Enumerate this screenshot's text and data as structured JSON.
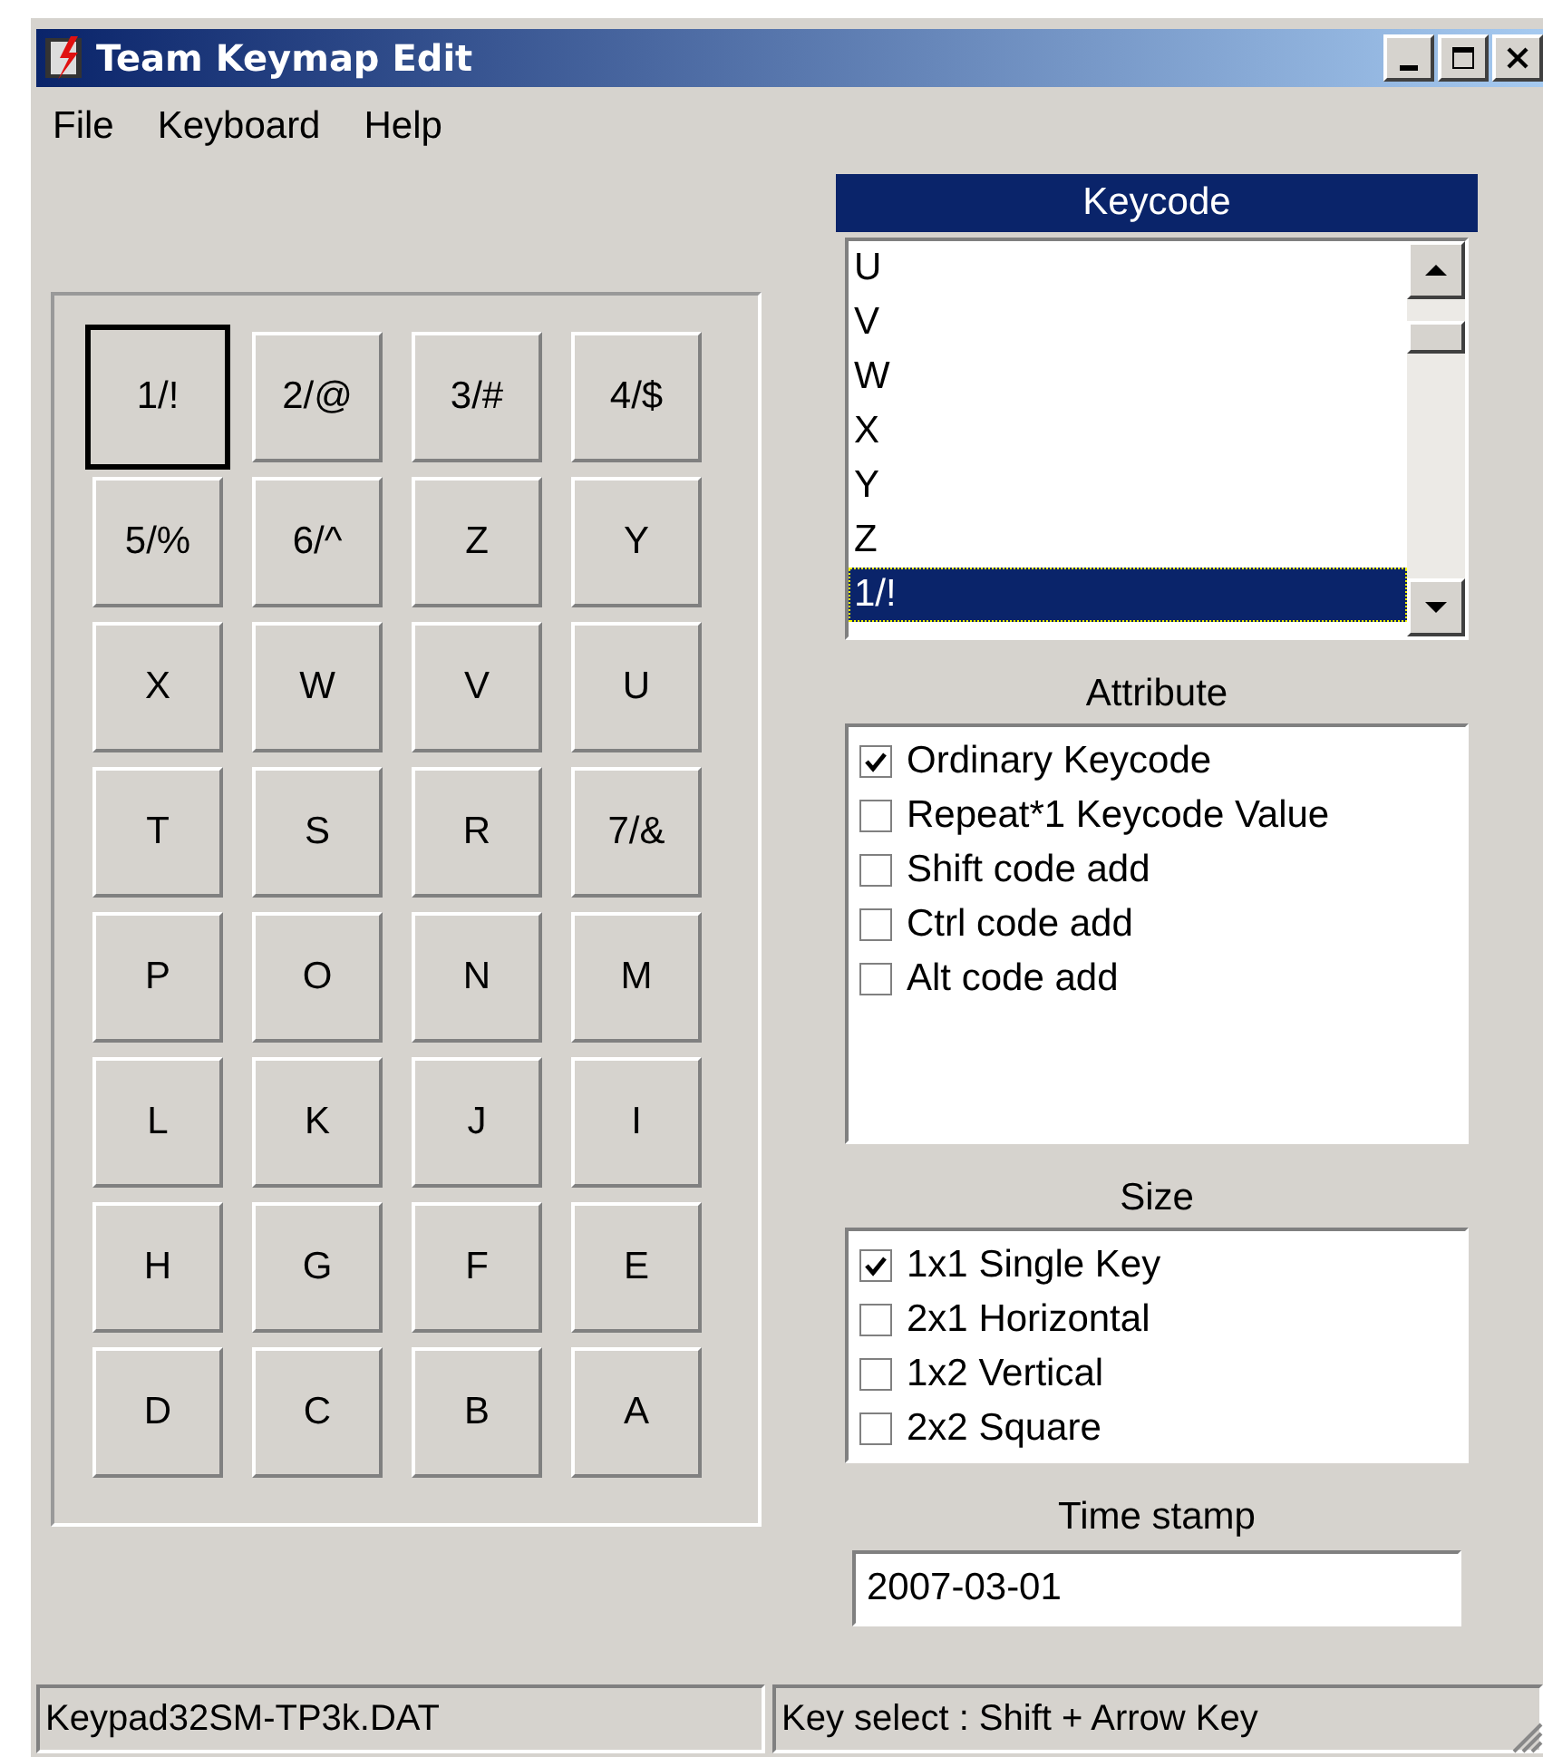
{
  "window": {
    "title": "Team Keymap Edit"
  },
  "menu": [
    "File",
    "Keyboard",
    "Help"
  ],
  "keys": [
    {
      "label": "1/!",
      "selected": true
    },
    {
      "label": "2/@",
      "selected": false
    },
    {
      "label": "3/#",
      "selected": false
    },
    {
      "label": "4/$",
      "selected": false
    },
    {
      "label": "5/%",
      "selected": false
    },
    {
      "label": "6/^",
      "selected": false
    },
    {
      "label": "Z",
      "selected": false
    },
    {
      "label": "Y",
      "selected": false
    },
    {
      "label": "X",
      "selected": false
    },
    {
      "label": "W",
      "selected": false
    },
    {
      "label": "V",
      "selected": false
    },
    {
      "label": "U",
      "selected": false
    },
    {
      "label": "T",
      "selected": false
    },
    {
      "label": "S",
      "selected": false
    },
    {
      "label": "R",
      "selected": false
    },
    {
      "label": "7/&",
      "selected": false
    },
    {
      "label": "P",
      "selected": false
    },
    {
      "label": "O",
      "selected": false
    },
    {
      "label": "N",
      "selected": false
    },
    {
      "label": "M",
      "selected": false
    },
    {
      "label": "L",
      "selected": false
    },
    {
      "label": "K",
      "selected": false
    },
    {
      "label": "J",
      "selected": false
    },
    {
      "label": "I",
      "selected": false
    },
    {
      "label": "H",
      "selected": false
    },
    {
      "label": "G",
      "selected": false
    },
    {
      "label": "F",
      "selected": false
    },
    {
      "label": "E",
      "selected": false
    },
    {
      "label": "D",
      "selected": false
    },
    {
      "label": "C",
      "selected": false
    },
    {
      "label": "B",
      "selected": false
    },
    {
      "label": "A",
      "selected": false
    }
  ],
  "keycode": {
    "title": "Keycode",
    "items": [
      {
        "label": "U",
        "selected": false
      },
      {
        "label": "V",
        "selected": false
      },
      {
        "label": "W",
        "selected": false
      },
      {
        "label": "X",
        "selected": false
      },
      {
        "label": "Y",
        "selected": false
      },
      {
        "label": "Z",
        "selected": false
      },
      {
        "label": "1/!",
        "selected": true
      }
    ]
  },
  "attribute": {
    "title": "Attribute",
    "items": [
      {
        "label": "Ordinary Keycode",
        "checked": true
      },
      {
        "label": "Repeat*1 Keycode Value",
        "checked": false
      },
      {
        "label": "Shift code add",
        "checked": false
      },
      {
        "label": "Ctrl code add",
        "checked": false
      },
      {
        "label": "Alt code add",
        "checked": false
      }
    ]
  },
  "size": {
    "title": "Size",
    "items": [
      {
        "label": "1x1 Single Key",
        "checked": true
      },
      {
        "label": "2x1 Horizontal",
        "checked": false
      },
      {
        "label": "1x2 Vertical",
        "checked": false
      },
      {
        "label": "2x2 Square",
        "checked": false
      }
    ]
  },
  "time_stamp": {
    "label": "Time stamp",
    "value": "2007-03-01"
  },
  "status_bar": [
    "Keypad32SM-TP3k.DAT",
    "Key select : Shift + Arrow Key"
  ]
}
